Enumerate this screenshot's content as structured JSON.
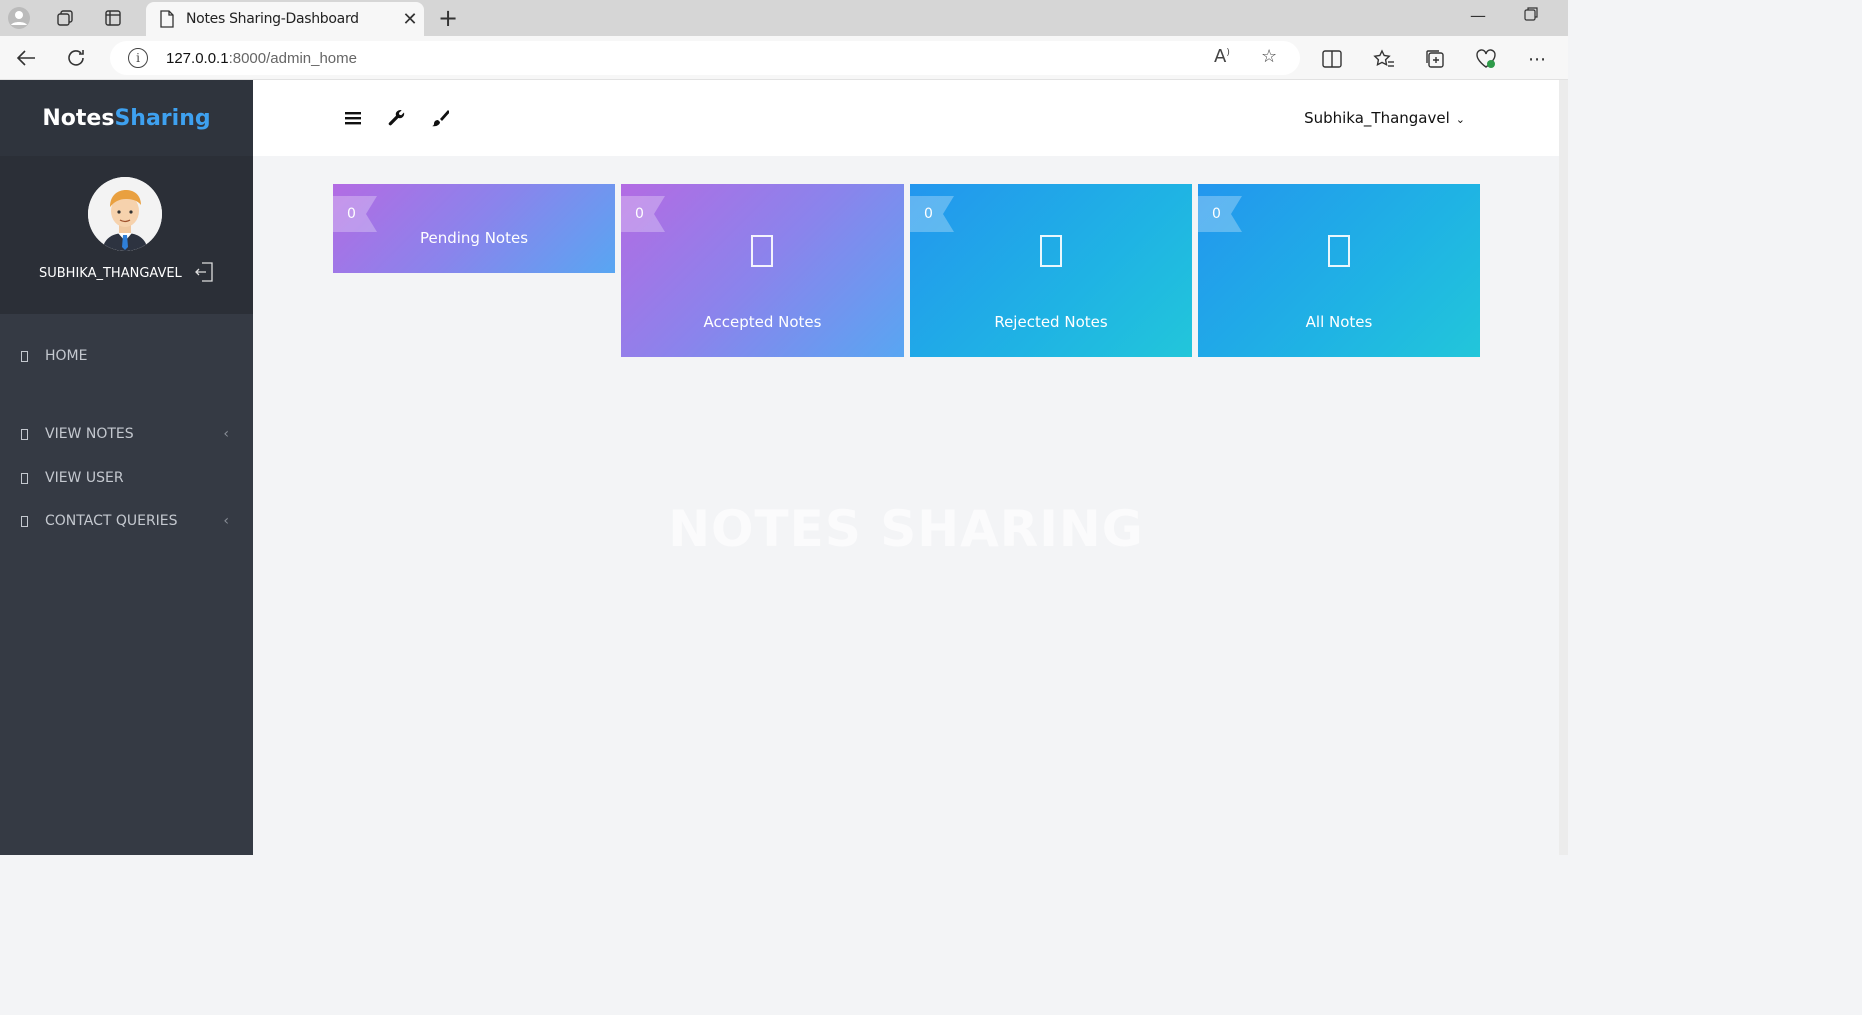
{
  "browser": {
    "tab_title": "Notes Sharing-Dashboard",
    "url_host": "127.0.0.1",
    "url_path": ":8000/admin_home"
  },
  "sidebar": {
    "brand_part1": "Notes",
    "brand_part2": "Sharing",
    "username": "SUBHIKA_THANGAVEL",
    "items": [
      {
        "label": "HOME",
        "has_caret": false
      },
      {
        "label": "VIEW NOTES",
        "has_caret": true
      },
      {
        "label": "VIEW USER",
        "has_caret": false
      },
      {
        "label": "CONTACT QUERIES",
        "has_caret": true
      }
    ],
    "caret_glyph": "‹"
  },
  "topbar": {
    "user_display": "Subhika_Thangavel",
    "chevron": "⌄"
  },
  "cards": [
    {
      "count": "0",
      "label": "Pending Notes",
      "style": "purple"
    },
    {
      "count": "0",
      "label": "Accepted Notes",
      "style": "purple"
    },
    {
      "count": "0",
      "label": "Rejected Notes",
      "style": "blue"
    },
    {
      "count": "0",
      "label": "All Notes",
      "style": "blue"
    }
  ],
  "watermark": "NOTES SHARING",
  "colors": {
    "sidebar_bg": "#353a44",
    "brand_accent": "#3ea1f0",
    "content_bg": "#f3f4f6"
  }
}
